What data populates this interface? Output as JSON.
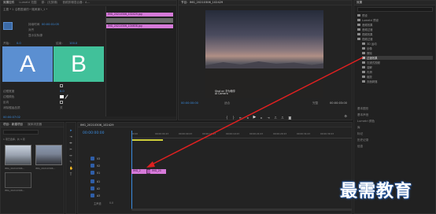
{
  "source_panel": {
    "tabs": [
      "效果控件",
      "Lumetri 范围",
      "源：(无剪辑)",
      "音频剪辑混合器：A..."
    ],
    "master_label": "主要 * 1 沿着国道的一路美景1_1 *",
    "clip_label": "沿着国道的一路美景1 *",
    "effect_section": "过渡效果",
    "props": [
      "持续时间",
      "对齐",
      "开始：",
      "结束："
    ],
    "duration_value": "00:00:01:05",
    "start_value": "0.0",
    "end_value": "100.0",
    "reverse_label": "显示实际源",
    "border_width": "边框宽度",
    "border_color": "边框颜色",
    "reverse": "反向",
    "antialias": "消除锯齿品质",
    "antialias_value": "关",
    "a_label": "A",
    "b_label": "B",
    "clip_a": "IMG_20210306_102429.jpg",
    "clip_b": "IMG_20210306_104608.jpg",
    "bottom_time": "00:00:07:02"
  },
  "program_panel": {
    "tab": "节目：IMG_20210306_102429",
    "timecode_left": "00:00:00:00",
    "fit": "适合",
    "quality": "完整",
    "timecode_right": "00:00:03:00",
    "watermark_line1": "Shot on 华为畅享",
    "watermark_line2": "AI Camera"
  },
  "project_panel": {
    "tabs": [
      "项目：新建项目",
      "媒体浏览器"
    ],
    "search_placeholder": "",
    "items": [
      {
        "name": "IMG_20210306..."
      },
      {
        "name": "IMG_20210306..."
      },
      {
        "name": "IMG_20210306..."
      }
    ],
    "count": "1 项已选择，共 3 项"
  },
  "timeline_panel": {
    "tab": "IMG_20210306_102429",
    "timecode": "00:00:00:00",
    "ruler": [
      "00:00",
      "00:00:04:23",
      "00:00:09:23",
      "00:00:14:23",
      "00:00:19:23",
      "00:00:24:23",
      "00:00:29:23",
      "00:00:34:23",
      "00:00:39:23",
      "00:00:44:22"
    ],
    "tracks": [
      "V3",
      "V2",
      "V1",
      "A1",
      "A2",
      "A3"
    ],
    "clip1": "IMG_2",
    "clip2": "IMG_20",
    "master": "主声道",
    "master_value": "0.0"
  },
  "effects_panel": {
    "tabs": [
      "效果"
    ],
    "tree": [
      "预设",
      "Lumetri 预设",
      "音频效果",
      "音频过渡",
      "视频效果",
      "视频过渡",
      "3D 运动",
      "划像",
      "擦除",
      "沉浸式视频",
      "溶解",
      "内滑",
      "缩放",
      "页面剥落",
      "过渡效果"
    ],
    "lower": [
      "基本图形",
      "基本声音",
      "Lumetri 颜色",
      "库",
      "标记",
      "历史记录",
      "信息"
    ]
  },
  "watermark": "最需教育",
  "colors": {
    "accent": "#3a8ce0",
    "clip": "#d67ad9",
    "arrow": "#e02020",
    "a_box": "#5b8fd1",
    "b_box": "#41c19a"
  }
}
